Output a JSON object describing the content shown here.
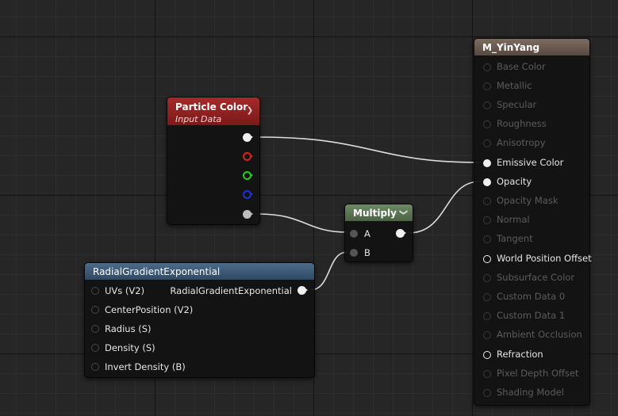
{
  "nodes": {
    "particle_color": {
      "title": "Particle Color",
      "subtitle": "Input Data"
    },
    "multiply": {
      "title": "Multiply",
      "input_a": "A",
      "input_b": "B"
    },
    "radial": {
      "title": "RadialGradientExponential",
      "output": "RadialGradientExponential",
      "inputs": [
        "UVs (V2)",
        "CenterPosition (V2)",
        "Radius (S)",
        "Density (S)",
        "Invert Density (B)"
      ]
    },
    "material": {
      "title": "M_YinYang",
      "inputs": [
        {
          "label": "Base Color",
          "active": false
        },
        {
          "label": "Metallic",
          "active": false
        },
        {
          "label": "Specular",
          "active": false
        },
        {
          "label": "Roughness",
          "active": false
        },
        {
          "label": "Anisotropy",
          "active": false
        },
        {
          "label": "Emissive Color",
          "active": true
        },
        {
          "label": "Opacity",
          "active": true
        },
        {
          "label": "Opacity Mask",
          "active": false
        },
        {
          "label": "Normal",
          "active": false
        },
        {
          "label": "Tangent",
          "active": false
        },
        {
          "label": "World Position Offset",
          "active": true
        },
        {
          "label": "Subsurface Color",
          "active": false
        },
        {
          "label": "Custom Data 0",
          "active": false
        },
        {
          "label": "Custom Data 1",
          "active": false
        },
        {
          "label": "Ambient Occlusion",
          "active": false
        },
        {
          "label": "Refraction",
          "active": true
        },
        {
          "label": "Pixel Depth Offset",
          "active": false
        },
        {
          "label": "Shading Model",
          "active": false
        }
      ]
    }
  },
  "colors": {
    "particle_header": "#8e1e1e",
    "multiply_header": "#5d7a55",
    "radial_header": "#3d5a78",
    "material_header": "#6b5a4e",
    "pin_white": "#f0f0f0",
    "pin_red": "#e02020",
    "pin_green": "#20d020",
    "pin_blue": "#2030e0",
    "pin_grey": "#bdbdbd",
    "wire": "#dcdcdc"
  }
}
